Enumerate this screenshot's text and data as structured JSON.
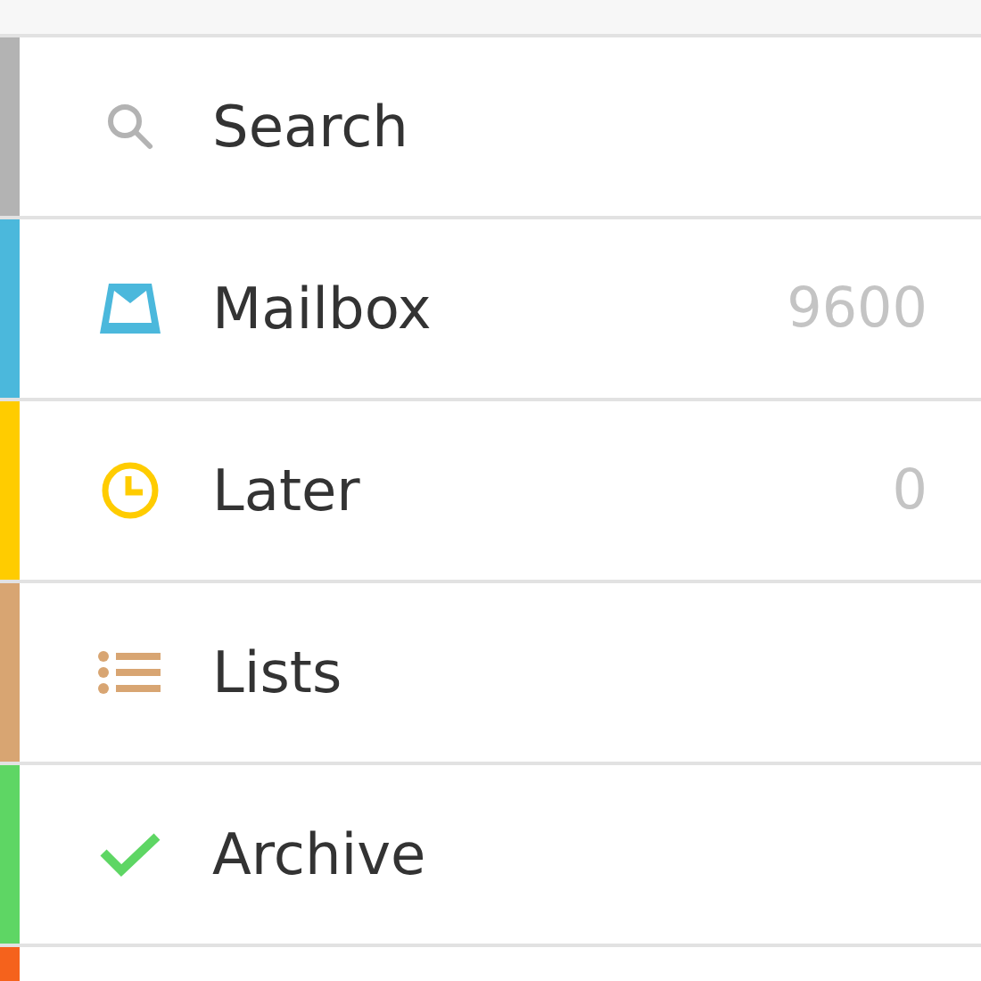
{
  "menu": {
    "items": [
      {
        "kind": "search",
        "label": "Search",
        "color": "#b3b3b3"
      },
      {
        "kind": "mailbox",
        "label": "Mailbox",
        "count": "9600",
        "color": "#4bb8dc"
      },
      {
        "kind": "clock",
        "label": "Later",
        "count": "0",
        "color": "#ffcc00"
      },
      {
        "kind": "list",
        "label": "Lists",
        "color": "#d8a572"
      },
      {
        "kind": "check",
        "label": "Archive",
        "color": "#5ed664"
      },
      {
        "kind": "hidden",
        "color": "#f5621c"
      }
    ]
  }
}
